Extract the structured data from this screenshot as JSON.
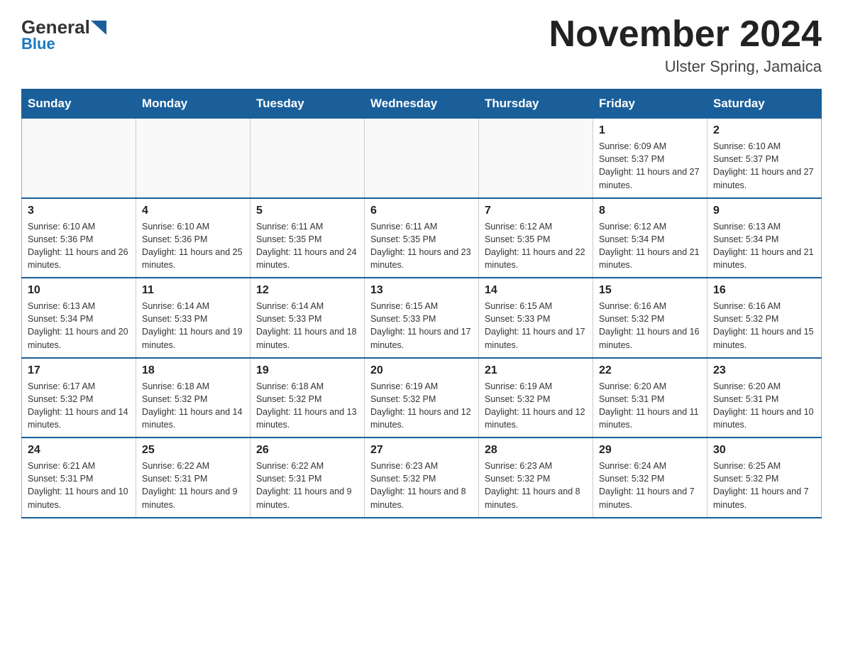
{
  "header": {
    "logo_general": "General",
    "logo_blue": "Blue",
    "month_title": "November 2024",
    "location": "Ulster Spring, Jamaica"
  },
  "days_of_week": [
    "Sunday",
    "Monday",
    "Tuesday",
    "Wednesday",
    "Thursday",
    "Friday",
    "Saturday"
  ],
  "weeks": [
    [
      {
        "day": "",
        "info": ""
      },
      {
        "day": "",
        "info": ""
      },
      {
        "day": "",
        "info": ""
      },
      {
        "day": "",
        "info": ""
      },
      {
        "day": "",
        "info": ""
      },
      {
        "day": "1",
        "info": "Sunrise: 6:09 AM\nSunset: 5:37 PM\nDaylight: 11 hours and 27 minutes."
      },
      {
        "day": "2",
        "info": "Sunrise: 6:10 AM\nSunset: 5:37 PM\nDaylight: 11 hours and 27 minutes."
      }
    ],
    [
      {
        "day": "3",
        "info": "Sunrise: 6:10 AM\nSunset: 5:36 PM\nDaylight: 11 hours and 26 minutes."
      },
      {
        "day": "4",
        "info": "Sunrise: 6:10 AM\nSunset: 5:36 PM\nDaylight: 11 hours and 25 minutes."
      },
      {
        "day": "5",
        "info": "Sunrise: 6:11 AM\nSunset: 5:35 PM\nDaylight: 11 hours and 24 minutes."
      },
      {
        "day": "6",
        "info": "Sunrise: 6:11 AM\nSunset: 5:35 PM\nDaylight: 11 hours and 23 minutes."
      },
      {
        "day": "7",
        "info": "Sunrise: 6:12 AM\nSunset: 5:35 PM\nDaylight: 11 hours and 22 minutes."
      },
      {
        "day": "8",
        "info": "Sunrise: 6:12 AM\nSunset: 5:34 PM\nDaylight: 11 hours and 21 minutes."
      },
      {
        "day": "9",
        "info": "Sunrise: 6:13 AM\nSunset: 5:34 PM\nDaylight: 11 hours and 21 minutes."
      }
    ],
    [
      {
        "day": "10",
        "info": "Sunrise: 6:13 AM\nSunset: 5:34 PM\nDaylight: 11 hours and 20 minutes."
      },
      {
        "day": "11",
        "info": "Sunrise: 6:14 AM\nSunset: 5:33 PM\nDaylight: 11 hours and 19 minutes."
      },
      {
        "day": "12",
        "info": "Sunrise: 6:14 AM\nSunset: 5:33 PM\nDaylight: 11 hours and 18 minutes."
      },
      {
        "day": "13",
        "info": "Sunrise: 6:15 AM\nSunset: 5:33 PM\nDaylight: 11 hours and 17 minutes."
      },
      {
        "day": "14",
        "info": "Sunrise: 6:15 AM\nSunset: 5:33 PM\nDaylight: 11 hours and 17 minutes."
      },
      {
        "day": "15",
        "info": "Sunrise: 6:16 AM\nSunset: 5:32 PM\nDaylight: 11 hours and 16 minutes."
      },
      {
        "day": "16",
        "info": "Sunrise: 6:16 AM\nSunset: 5:32 PM\nDaylight: 11 hours and 15 minutes."
      }
    ],
    [
      {
        "day": "17",
        "info": "Sunrise: 6:17 AM\nSunset: 5:32 PM\nDaylight: 11 hours and 14 minutes."
      },
      {
        "day": "18",
        "info": "Sunrise: 6:18 AM\nSunset: 5:32 PM\nDaylight: 11 hours and 14 minutes."
      },
      {
        "day": "19",
        "info": "Sunrise: 6:18 AM\nSunset: 5:32 PM\nDaylight: 11 hours and 13 minutes."
      },
      {
        "day": "20",
        "info": "Sunrise: 6:19 AM\nSunset: 5:32 PM\nDaylight: 11 hours and 12 minutes."
      },
      {
        "day": "21",
        "info": "Sunrise: 6:19 AM\nSunset: 5:32 PM\nDaylight: 11 hours and 12 minutes."
      },
      {
        "day": "22",
        "info": "Sunrise: 6:20 AM\nSunset: 5:31 PM\nDaylight: 11 hours and 11 minutes."
      },
      {
        "day": "23",
        "info": "Sunrise: 6:20 AM\nSunset: 5:31 PM\nDaylight: 11 hours and 10 minutes."
      }
    ],
    [
      {
        "day": "24",
        "info": "Sunrise: 6:21 AM\nSunset: 5:31 PM\nDaylight: 11 hours and 10 minutes."
      },
      {
        "day": "25",
        "info": "Sunrise: 6:22 AM\nSunset: 5:31 PM\nDaylight: 11 hours and 9 minutes."
      },
      {
        "day": "26",
        "info": "Sunrise: 6:22 AM\nSunset: 5:31 PM\nDaylight: 11 hours and 9 minutes."
      },
      {
        "day": "27",
        "info": "Sunrise: 6:23 AM\nSunset: 5:32 PM\nDaylight: 11 hours and 8 minutes."
      },
      {
        "day": "28",
        "info": "Sunrise: 6:23 AM\nSunset: 5:32 PM\nDaylight: 11 hours and 8 minutes."
      },
      {
        "day": "29",
        "info": "Sunrise: 6:24 AM\nSunset: 5:32 PM\nDaylight: 11 hours and 7 minutes."
      },
      {
        "day": "30",
        "info": "Sunrise: 6:25 AM\nSunset: 5:32 PM\nDaylight: 11 hours and 7 minutes."
      }
    ]
  ]
}
